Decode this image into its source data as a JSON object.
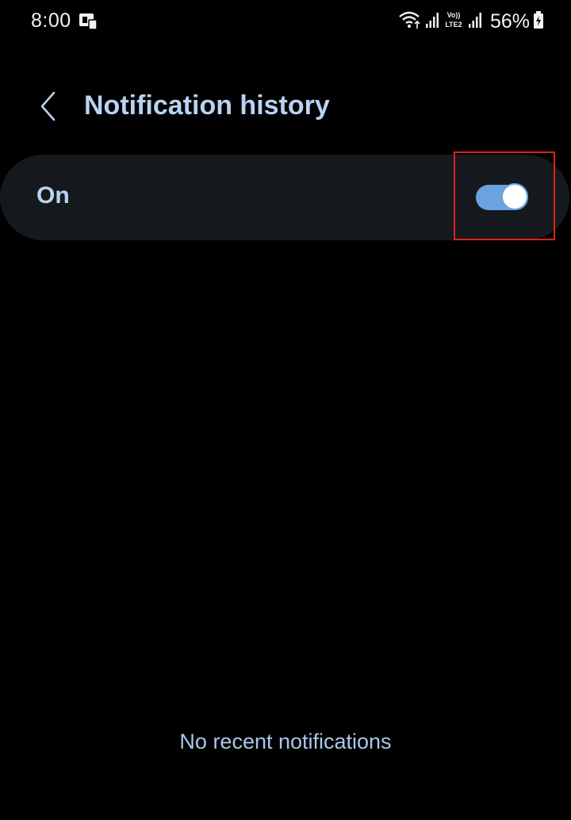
{
  "status_bar": {
    "time": "8:00",
    "network_label": "Vo) LTE2",
    "battery": "56%",
    "icons": [
      "app-notification-icon",
      "wifi-icon",
      "signal-icon",
      "volte-icon",
      "signal-icon",
      "battery-charging-icon"
    ]
  },
  "header": {
    "back_icon": "chevron-left-icon",
    "title": "Notification history"
  },
  "setting": {
    "label": "On",
    "toggle_state": "on"
  },
  "empty_state": {
    "message": "No recent notifications"
  },
  "colors": {
    "background": "#000000",
    "card": "#15191d",
    "accent": "#6aa3e0",
    "title_text": "#b9d3f1",
    "highlight": "#e0201e"
  }
}
